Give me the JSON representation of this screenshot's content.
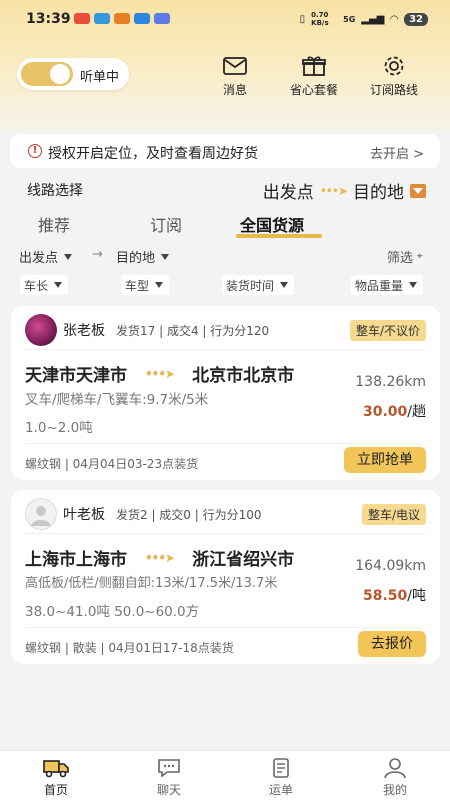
{
  "status": {
    "time": "13:39",
    "network": "0.70 KB/s",
    "signal": "5G",
    "battery": "32"
  },
  "header": {
    "listen_toggle": "听单中",
    "buttons": [
      {
        "label": "消息",
        "icon": "mail-icon"
      },
      {
        "label": "省心套餐",
        "icon": "gift-icon"
      },
      {
        "label": "订阅路线",
        "icon": "gear-icon"
      }
    ]
  },
  "banner": {
    "text": "授权开启定位，及时查看周边好货",
    "action": "去开启 >"
  },
  "route": {
    "label": "线路选择",
    "from": "出发点",
    "to": "目的地"
  },
  "tabs": [
    "推荐",
    "订阅",
    "全国货源"
  ],
  "active_tab": "全国货源",
  "filters": {
    "from": "出发点",
    "to": "目的地",
    "screen": "筛选",
    "chips": [
      "车长",
      "车型",
      "装货时间",
      "物品重量"
    ]
  },
  "cards": [
    {
      "name": "张老板",
      "stats": "发货17 | 成交4 | 行为分120",
      "tag": "整车/不议价",
      "from": "天津市天津市",
      "to": "北京市北京市",
      "distance": "138.26km",
      "vehicle": "叉车/爬梯车/飞翼车:9.7米/5米",
      "weight": "1.0~2.0吨",
      "price_value": "30.00",
      "price_unit": "/趟",
      "footer": "螺纹钢 | 04月04日03-23点装货",
      "action": "立即抢单"
    },
    {
      "name": "叶老板",
      "stats": "发货2 | 成交0 | 行为分100",
      "tag": "整车/电议",
      "from": "上海市上海市",
      "to": "浙江省绍兴市",
      "distance": "164.09km",
      "vehicle": "高低板/低栏/侧翻自卸:13米/17.5米/13.7米",
      "weight": "38.0~41.0吨 50.0~60.0方",
      "price_value": "58.50",
      "price_unit": "/吨",
      "footer": "螺纹钢 | 散装 | 04月01日17-18点装货",
      "action": "去报价"
    }
  ],
  "nav": [
    {
      "label": "首页",
      "icon": "truck-icon"
    },
    {
      "label": "聊天",
      "icon": "chat-icon"
    },
    {
      "label": "运单",
      "icon": "document-icon"
    },
    {
      "label": "我的",
      "icon": "person-icon"
    }
  ]
}
